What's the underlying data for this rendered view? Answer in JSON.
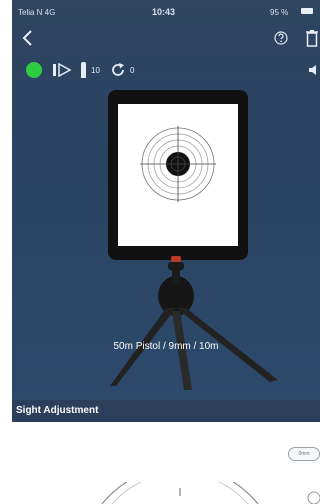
{
  "status": {
    "carrier": "Telia N  4G",
    "time": "10:43",
    "battery": "95 %"
  },
  "toolbar": {
    "ammo_count": "10",
    "reload_count": "0"
  },
  "scene": {
    "caption": "50m Pistol / 9mm / 10m"
  },
  "section": {
    "title": "Sight Adjustment"
  },
  "controls": {
    "unit_toggle": "0mm"
  },
  "icons": [
    "back-icon",
    "help-icon",
    "trash-icon",
    "skip-icon",
    "ammo-icon",
    "reload-icon",
    "sound-icon"
  ],
  "colors": {
    "panel": "#2a4363",
    "online": "#2ecc40",
    "section_bar": "#2b3f5a"
  }
}
